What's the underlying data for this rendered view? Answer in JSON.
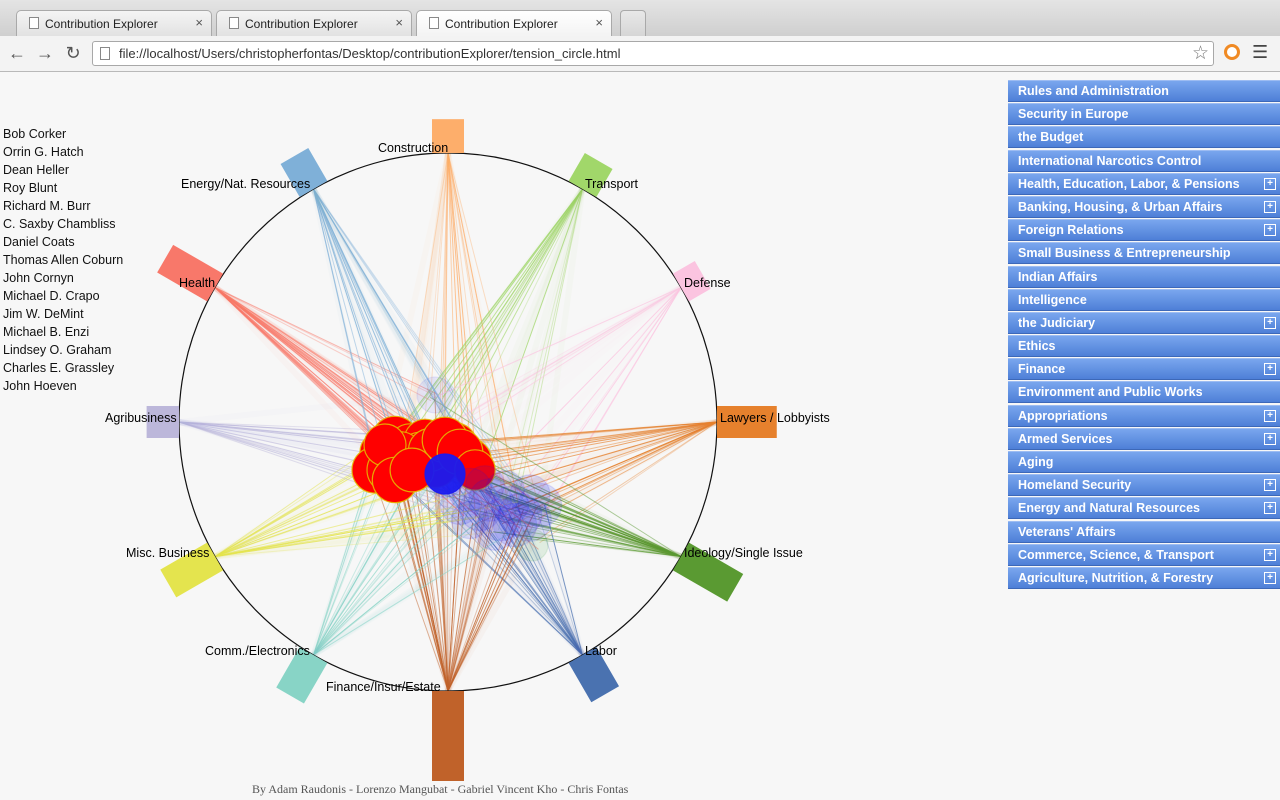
{
  "browser": {
    "tabs": [
      {
        "title": "Contribution Explorer"
      },
      {
        "title": "Contribution Explorer"
      },
      {
        "title": "Contribution Explorer"
      }
    ],
    "close_glyph": "×",
    "url": "file://localhost/Users/christopherfontas/Desktop/contributionExplorer/tension_circle.html",
    "icons": {
      "back": "back-arrow-icon",
      "forward": "forward-arrow-icon",
      "reload": "reload-icon",
      "star": "bookmark-star-icon",
      "menu": "menu-icon"
    }
  },
  "senators": [
    "Bob Corker",
    "Orrin G. Hatch",
    "Dean Heller",
    "Roy Blunt",
    "Richard M. Burr",
    "C. Saxby Chambliss",
    "Daniel Coats",
    "Thomas Allen Coburn",
    "John Cornyn",
    "Michael D. Crapo",
    "Jim W. DeMint",
    "Michael B. Enzi",
    "Lindsey O. Graham",
    "Charles E. Grassley",
    "John Hoeven"
  ],
  "committees": [
    {
      "label": "Rules and Administration",
      "expandable": false
    },
    {
      "label": "Security in Europe",
      "expandable": false
    },
    {
      "label": "the Budget",
      "expandable": false
    },
    {
      "label": "International Narcotics Control",
      "expandable": false
    },
    {
      "label": "Health, Education, Labor, & Pensions",
      "expandable": true
    },
    {
      "label": "Banking, Housing, & Urban Affairs",
      "expandable": true
    },
    {
      "label": "Foreign Relations",
      "expandable": true
    },
    {
      "label": "Small Business & Entrepreneurship",
      "expandable": false
    },
    {
      "label": "Indian Affairs",
      "expandable": false
    },
    {
      "label": "Intelligence",
      "expandable": false
    },
    {
      "label": "the Judiciary",
      "expandable": true
    },
    {
      "label": "Ethics",
      "expandable": false
    },
    {
      "label": "Finance",
      "expandable": true
    },
    {
      "label": "Environment and Public Works",
      "expandable": false
    },
    {
      "label": "Appropriations",
      "expandable": true
    },
    {
      "label": "Armed Services",
      "expandable": true
    },
    {
      "label": "Aging",
      "expandable": false
    },
    {
      "label": "Homeland Security",
      "expandable": true
    },
    {
      "label": "Energy and Natural Resources",
      "expandable": true
    },
    {
      "label": "Veterans' Affairs",
      "expandable": false
    },
    {
      "label": "Commerce, Science, & Transport",
      "expandable": true
    },
    {
      "label": "Agriculture, Nutrition, & Forestry",
      "expandable": true
    }
  ],
  "industries": [
    {
      "label": "Construction",
      "color": "#fdae6b",
      "angle_deg": -90,
      "amount": 0.22
    },
    {
      "label": "Transport",
      "color": "#a1d76a",
      "angle_deg": -60,
      "amount": 0.2
    },
    {
      "label": "Defense",
      "color": "#fbc4e0",
      "angle_deg": -30,
      "amount": 0.1
    },
    {
      "label": "Lawyers / Lobbyists",
      "color": "#e6812d",
      "angle_deg": 0,
      "amount": 0.58
    },
    {
      "label": "Ideology/Single Issue",
      "color": "#5a9a32",
      "angle_deg": 30,
      "amount": 0.62
    },
    {
      "label": "Labor",
      "color": "#4a72b0",
      "angle_deg": 60,
      "amount": 0.38
    },
    {
      "label": "Finance/Insur/Estate",
      "color": "#c0622a",
      "angle_deg": 90,
      "amount": 1.0
    },
    {
      "label": "Comm./Electronics",
      "color": "#88d4c6",
      "angle_deg": 120,
      "amount": 0.4
    },
    {
      "label": "Misc. Business",
      "color": "#e4e44e",
      "angle_deg": 150,
      "amount": 0.5
    },
    {
      "label": "Agribusiness",
      "color": "#bcb7da",
      "angle_deg": 180,
      "amount": 0.2
    },
    {
      "label": "Health",
      "color": "#f8786a",
      "angle_deg": 210,
      "amount": 0.55
    },
    {
      "label": "Energy/Nat. Resources",
      "color": "#7fb0d8",
      "angle_deg": 240,
      "amount": 0.28
    }
  ],
  "node_colors": {
    "republican": "#ff0000",
    "democrat": "#1a1aee",
    "independent": "#2f9e3a",
    "node_stroke": "#e6b800"
  },
  "credits": "By Adam Raudonis - Lorenzo Mangubat - Gabriel Vincent Kho - Chris Fontas"
}
